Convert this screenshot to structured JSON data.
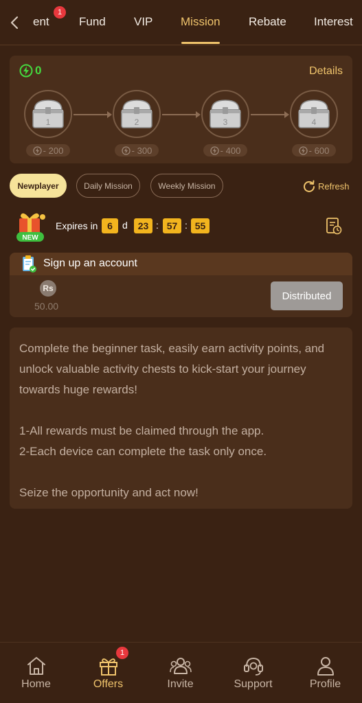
{
  "tabs": {
    "items": [
      {
        "label": "ent"
      },
      {
        "label": "Fund"
      },
      {
        "label": "VIP"
      },
      {
        "label": "Mission"
      },
      {
        "label": "Rebate"
      },
      {
        "label": "Interest"
      }
    ],
    "active": "Mission",
    "badge": "1"
  },
  "chests": {
    "points": "0",
    "details_label": "Details",
    "items": [
      {
        "number": "1",
        "cost": "- 200"
      },
      {
        "number": "2",
        "cost": "- 300"
      },
      {
        "number": "3",
        "cost": "- 400"
      },
      {
        "number": "4",
        "cost": "- 600"
      }
    ]
  },
  "filters": {
    "items": [
      {
        "label": "Newplayer",
        "active": true
      },
      {
        "label": "Daily Mission",
        "active": false
      },
      {
        "label": "Weekly Mission",
        "active": false
      }
    ],
    "refresh_label": "Refresh"
  },
  "timer": {
    "new_label": "NEW",
    "expires_label": "Expires in",
    "days": "6",
    "day_unit": "d",
    "hours": "23",
    "minutes": "57",
    "seconds": "55",
    "separator": ":"
  },
  "task": {
    "title": "Sign up an account",
    "currency_symbol": "Rs",
    "reward": "50.00",
    "status_button": "Distributed"
  },
  "description": {
    "intro": "Complete the beginner task, easily earn activity points, and unlock valuable activity chests to kick-start your journey towards huge rewards!",
    "rule1": "1-All rewards must be claimed through the app.",
    "rule2": "2-Each device can complete the task only once.",
    "outro": "Seize the opportunity and act now!"
  },
  "bottom_nav": {
    "items": [
      {
        "label": "Home",
        "icon": "home-icon"
      },
      {
        "label": "Offers",
        "icon": "gift-icon",
        "badge": "1",
        "active": true
      },
      {
        "label": "Invite",
        "icon": "people-icon"
      },
      {
        "label": "Support",
        "icon": "headset-icon"
      },
      {
        "label": "Profile",
        "icon": "user-icon"
      }
    ]
  },
  "colors": {
    "background": "#3a2213",
    "card": "#4a2e1b",
    "accent": "#f0c46c",
    "points_green": "#45d93f",
    "timer_box": "#f2b41e",
    "badge_red": "#e8383d"
  }
}
